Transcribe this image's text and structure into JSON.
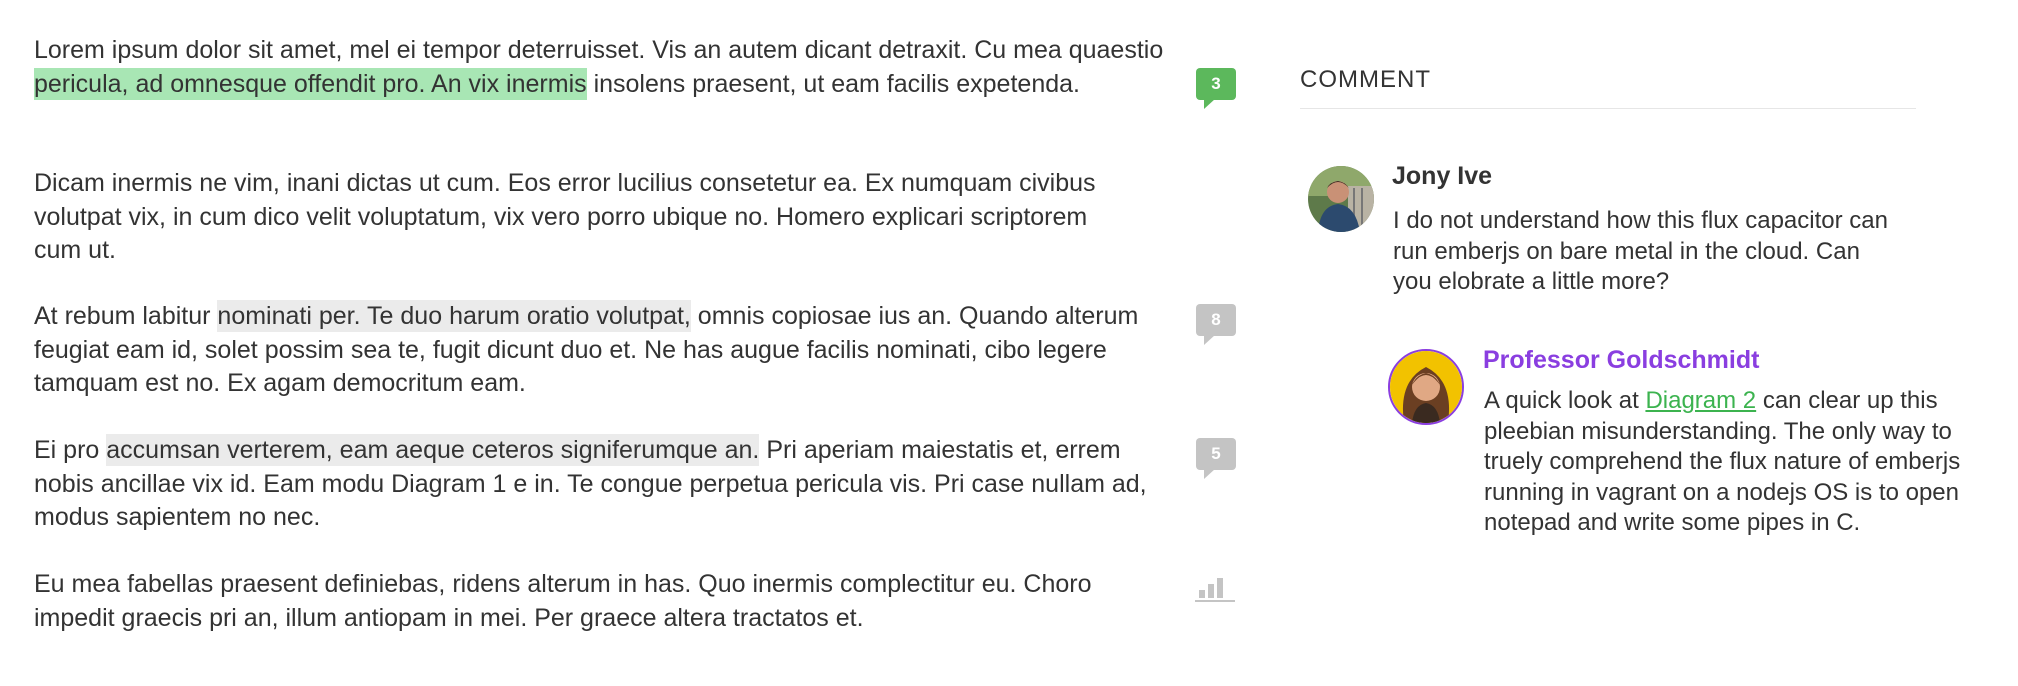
{
  "paragraphs": [
    {
      "before": "Lorem ipsum dolor sit amet, mel ei tempor deterruisset. Vis an autem dicant detraxit. Cu mea quaestio ",
      "highlight": "pericula, ad omnesque offendit pro. An vix inermis",
      "after": " insolens praesent, ut eam facilis expetenda."
    },
    {
      "text": "Dicam inermis ne vim, inani dictas ut cum. Eos error lucilius consetetur ea. Ex numquam civibus volutpat vix, in cum dico velit voluptatum, vix vero porro ubique no. Homero explicari scriptorem cum ut."
    },
    {
      "before": "At rebum labitur ",
      "highlight": "nominati per. Te duo harum oratio volutpat,",
      "after": " omnis copiosae ius an. Quando alterum feugiat eam id, solet possim sea te, fugit dicunt duo et. Ne has augue facilis nominati, cibo legere tamquam est no. Ex agam democritum eam."
    },
    {
      "before": "Ei pro ",
      "highlight": "accumsan verterem, eam aeque ceteros signiferumque an.",
      "after": " Pri aperiam maiestatis et, errem nobis ancillae vix id. Eam modu Diagram 1 e in. Te congue perpetua pericula vis. Pri case nullam ad, modus sapientem no nec."
    },
    {
      "text": "Eu mea fabellas praesent definiebas, ridens alterum in has. Quo inermis complectitur eu. Choro impedit graecis pri an, illum antiopam in mei. Per graece altera tractatos et."
    }
  ],
  "markers": [
    {
      "count": "3",
      "state": "active",
      "color": "#5cb85c"
    },
    {
      "count": "8",
      "state": "inactive",
      "color": "#c4c4c4"
    },
    {
      "count": "5",
      "state": "inactive",
      "color": "#c4c4c4"
    }
  ],
  "chart_icon": "bar-chart-icon",
  "panel": {
    "title": "COMMENT",
    "comments": [
      {
        "author": "Jony Ive",
        "avatar": "avatar-photo-man",
        "body": "I do not understand how this flux capacitor can run emberjs on bare metal in the cloud. Can you elobrate a little more?"
      },
      {
        "author": "Professor Goldschmidt",
        "author_color": "#8a3ee0",
        "avatar": "avatar-photo-woman",
        "body_before": "A quick look at ",
        "link": "Diagram 2",
        "body_after": " can clear up this pleebian misunderstanding. The only way to truely comprehend the flux nature of emberjs running in vagrant on a nodejs OS is to open notepad and write some pipes in C."
      }
    ]
  },
  "colors": {
    "highlight_active": "#a8e6b4",
    "highlight_inactive": "#ebebeb",
    "link": "#3cb34f"
  }
}
